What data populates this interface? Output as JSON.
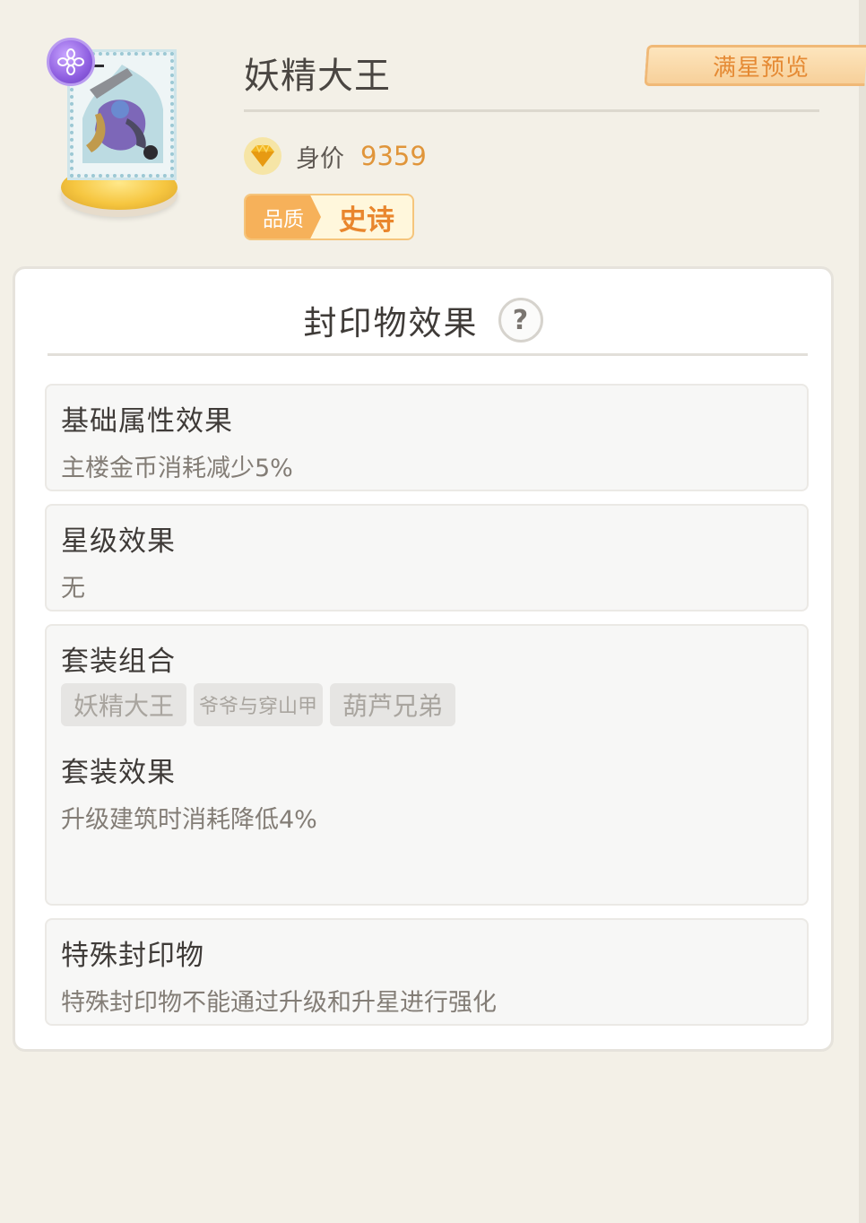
{
  "item": {
    "name": "妖精大王",
    "price_label": "身价",
    "price_value": "9359",
    "quality_label": "品质",
    "quality_value": "史诗"
  },
  "header": {
    "preview_label": "满星预览"
  },
  "panel": {
    "title": "封印物效果",
    "help": "?",
    "basic": {
      "title": "基础属性效果",
      "text": "主楼金币消耗减少5%"
    },
    "star": {
      "title": "星级效果",
      "text": "无"
    },
    "set": {
      "title": "套装组合",
      "tags": [
        "妖精大王",
        "爷爷与穿山甲",
        "葫芦兄弟"
      ],
      "effect_title": "套装效果",
      "effect_text": "升级建筑时消耗降低4%"
    },
    "special": {
      "title": "特殊封印物",
      "text": "特殊封印物不能通过升级和升星进行强化"
    }
  },
  "colors": {
    "background": "#f3f0e7",
    "accent_orange": "#e0953a",
    "quality_orange": "#f6b15a",
    "rank_purple": "#8e5ee0"
  },
  "icons": [
    "rank-badge-icon",
    "diamond-icon",
    "help-icon"
  ]
}
